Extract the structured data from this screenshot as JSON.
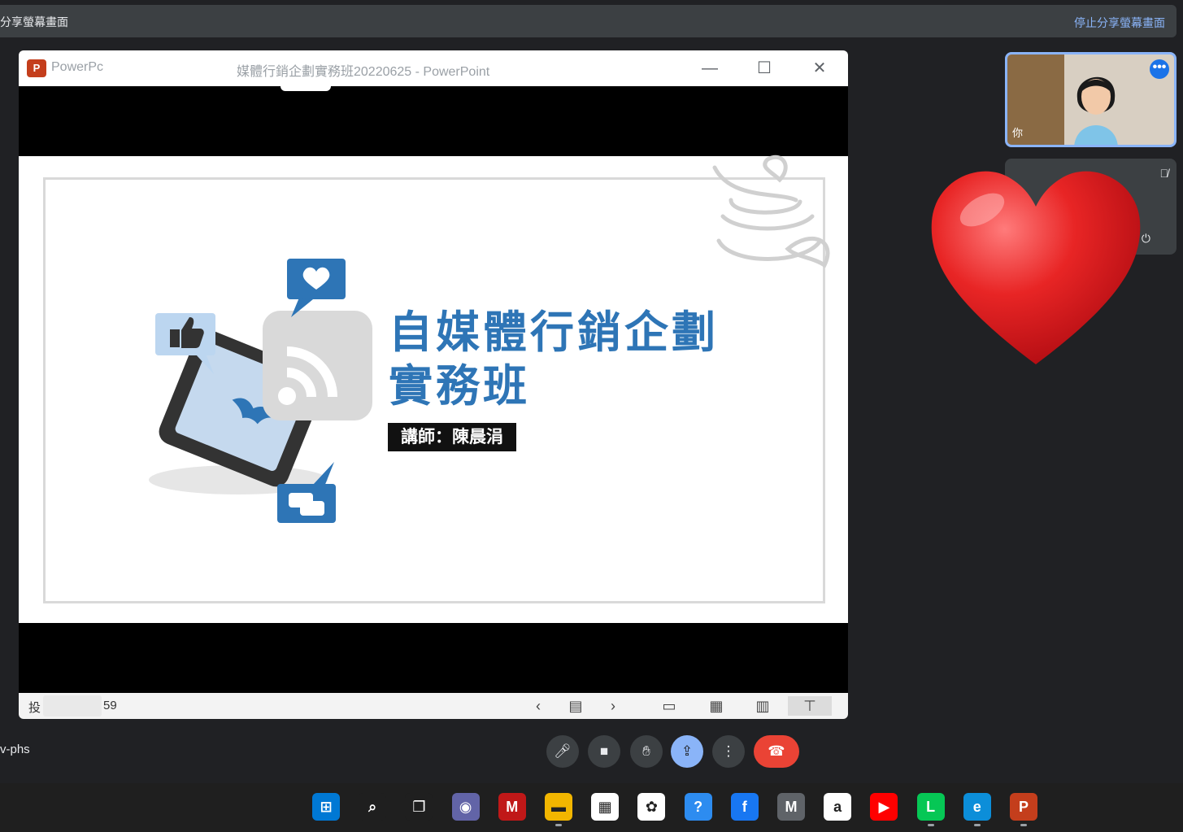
{
  "share_bar": {
    "title": "分享螢幕畫面",
    "stop_label": "停止分享螢幕畫面"
  },
  "ppt": {
    "app_name": "PowerPc",
    "document_title": "媒體行銷企劃實務班20220625 - PowerPoint",
    "window_controls": {
      "minimize": "—",
      "maximize": "☐",
      "close": "✕"
    },
    "status": {
      "slide_info": "投",
      "slide_suffix": "59"
    },
    "nav": {
      "prev": "‹",
      "next": "›"
    }
  },
  "slide": {
    "title_line1": "自媒體行銷企劃",
    "title_line2": "實務班",
    "instructor": "講師：陳晨涓",
    "accent_color": "#2e75b6"
  },
  "participants": {
    "self_label": "你",
    "self_menu_icon": "more-dots-icon",
    "other_muted_icon": "mic-off-icon"
  },
  "reaction": {
    "emoji": "heart-icon",
    "color": "#e02828"
  },
  "meeting": {
    "code": "v-phs",
    "controls": {
      "mic": "mic-icon",
      "camera": "camera-icon",
      "raise_hand": "hand-icon",
      "present": "present-icon",
      "more": "more-vert-icon",
      "hangup": "hangup-icon"
    }
  },
  "taskbar": {
    "apps": [
      {
        "name": "windows-start",
        "glyph": "⊞",
        "color": "#0078d4"
      },
      {
        "name": "search",
        "glyph": "⌕",
        "color": "#1f1f1f"
      },
      {
        "name": "task-view",
        "glyph": "❐",
        "color": "#1f1f1f"
      },
      {
        "name": "teams-chat",
        "glyph": "◉",
        "color": "#6264a7"
      },
      {
        "name": "mcafee",
        "glyph": "M",
        "color": "#c01818"
      },
      {
        "name": "file-explorer",
        "glyph": "▬",
        "color": "#f2b600"
      },
      {
        "name": "microsoft-store",
        "glyph": "▦",
        "color": "#ffffff"
      },
      {
        "name": "chatgpt",
        "glyph": "✿",
        "color": "#ffffff"
      },
      {
        "name": "help",
        "glyph": "?",
        "color": "#2d8cf0"
      },
      {
        "name": "facebook",
        "glyph": "f",
        "color": "#1877f2"
      },
      {
        "name": "gmail-m",
        "glyph": "M",
        "color": "#5f6368"
      },
      {
        "name": "amazon",
        "glyph": "a",
        "color": "#ffffff"
      },
      {
        "name": "youtube",
        "glyph": "▶",
        "color": "#ff0000"
      },
      {
        "name": "line",
        "glyph": "L",
        "color": "#06c755"
      },
      {
        "name": "edge",
        "glyph": "e",
        "color": "#0c8ed9"
      },
      {
        "name": "powerpoint",
        "glyph": "P",
        "color": "#c43e1c"
      }
    ]
  }
}
